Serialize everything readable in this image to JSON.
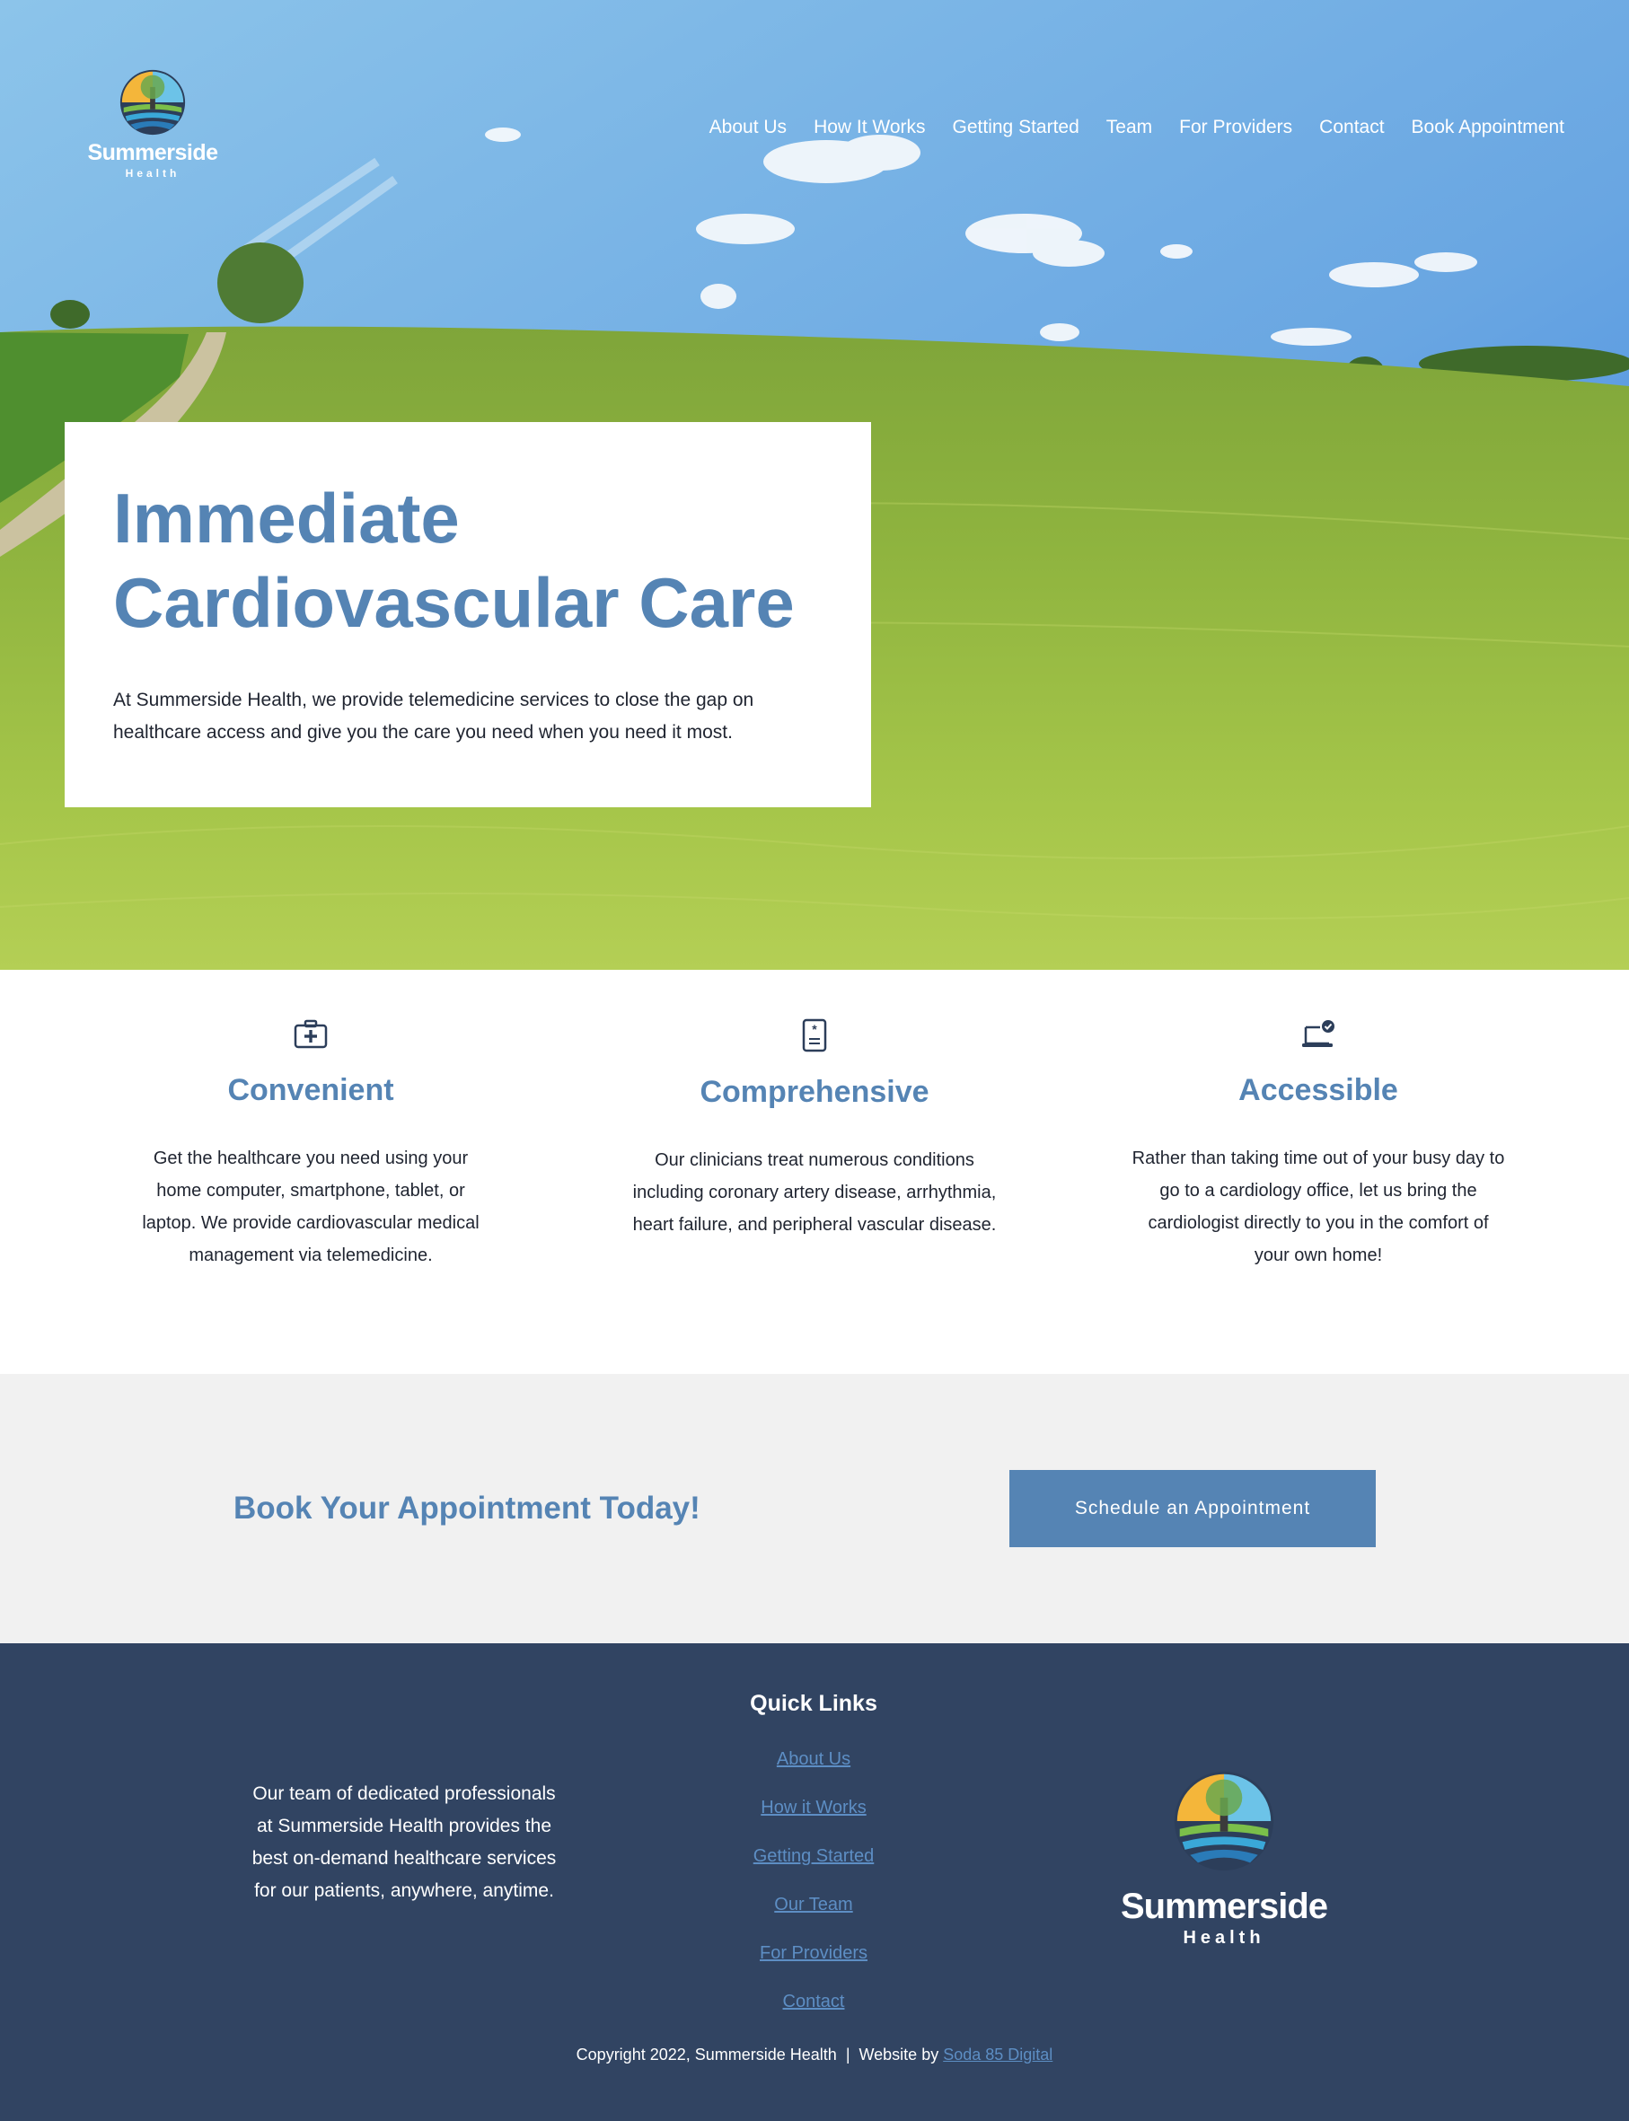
{
  "brand": {
    "name": "Summerside",
    "sub": "Health"
  },
  "nav": [
    "About Us",
    "How It Works",
    "Getting Started",
    "Team",
    "For Providers",
    "Contact",
    "Book Appointment"
  ],
  "hero": {
    "title_line1": "Immediate",
    "title_line2": "Cardiovascular Care",
    "body": "At Summerside Health, we provide telemedicine services to close the gap on healthcare access and give you the care you need when you need it most."
  },
  "features": [
    {
      "icon": "medical-bag-icon",
      "title": "Convenient",
      "body": "Get the healthcare you need using your home computer, smartphone, tablet, or laptop. We provide cardiovascular medical management via telemedicine."
    },
    {
      "icon": "medical-document-icon",
      "title": "Comprehensive",
      "body": "Our clinicians treat numerous conditions including coronary artery disease, arrhythmia, heart failure, and peripheral vascular disease."
    },
    {
      "icon": "laptop-check-icon",
      "title": "Accessible",
      "body": "Rather than taking time out of your busy day to go to a cardiology office, let us bring the cardiologist directly to you in the comfort of your own home!"
    }
  ],
  "cta": {
    "heading": "Book Your Appointment Today!",
    "button": "Schedule an Appointment"
  },
  "footer": {
    "about": "Our team of dedicated professionals at Summerside Health provides the best on-demand healthcare services for our patients, anywhere, anytime.",
    "links_title": "Quick Links",
    "links": [
      "About Us",
      "How it Works",
      "Getting Started",
      "Our Team",
      "For Providers",
      "Contact"
    ],
    "copyright": "Copyright 2022, Summerside Health  |  Website by ",
    "credit": "Soda 85 Digital"
  },
  "colors": {
    "accent": "#5584b4",
    "footer_bg": "#314462",
    "link": "#5d8ec4",
    "cta_bg": "#f1f1f1"
  }
}
